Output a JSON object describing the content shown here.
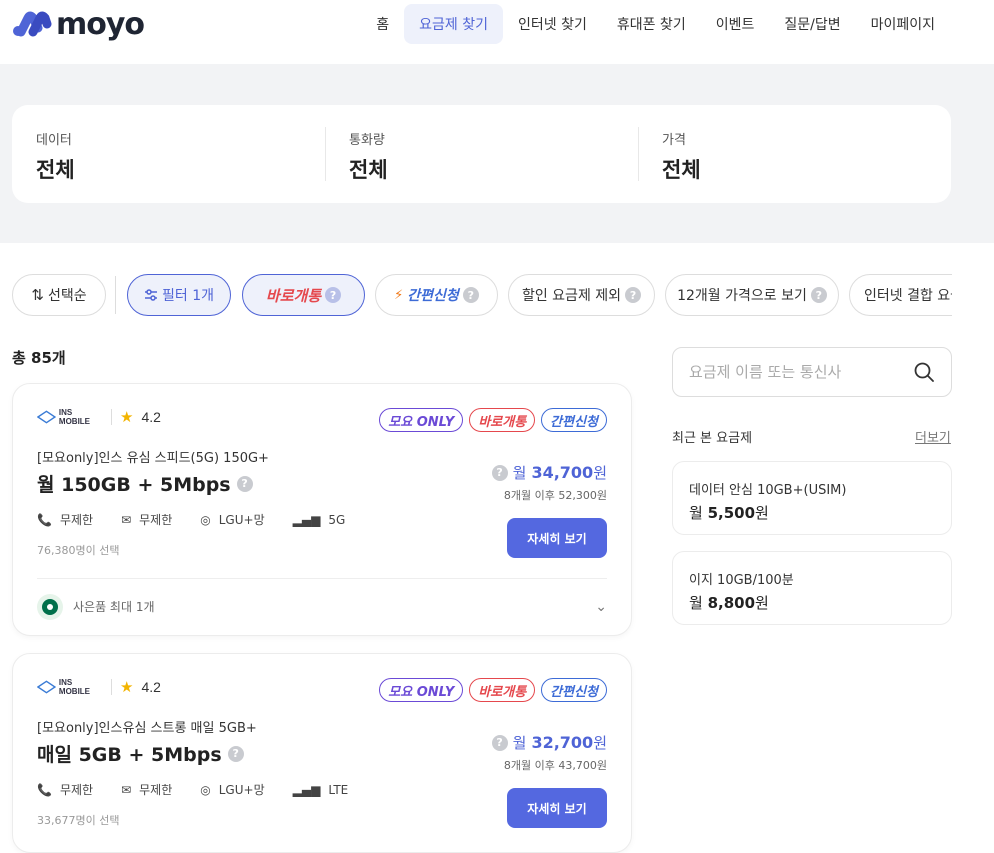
{
  "header": {
    "logo_text": "moyo",
    "nav": [
      "홈",
      "요금제 찾기",
      "인터넷 찾기",
      "휴대폰 찾기",
      "이벤트",
      "질문/답변",
      "마이페이지"
    ]
  },
  "filters": [
    {
      "label": "데이터",
      "value": "전체"
    },
    {
      "label": "통화량",
      "value": "전체"
    },
    {
      "label": "가격",
      "value": "전체"
    }
  ],
  "chips": {
    "sort": "선택순",
    "filter": "필터 1개",
    "instant": "바로개통",
    "easy": "간편신청",
    "exclude_discount": "할인 요금제 제외",
    "twelve_month": "12개월 가격으로 보기",
    "internet": "인터넷 결합 요금"
  },
  "total": "총 85개",
  "plans": [
    {
      "carrier": "INS MOBILE",
      "rating": "4.2",
      "badges": [
        "모요 ONLY",
        "바로개통",
        "간편신청"
      ],
      "name": "[모요only]인스 유심 스피드(5G) 150G+",
      "title": "월 150GB + 5Mbps",
      "specs": [
        "무제한",
        "무제한",
        "LGU+망",
        "5G"
      ],
      "chosen": "76,380명이 선택",
      "price_prefix": "월",
      "price": "34,700",
      "price_unit": "원",
      "after": "8개월 이후 52,300원",
      "detail": "자세히 보기",
      "gift": "사은품 최대 1개"
    },
    {
      "carrier": "INS MOBILE",
      "rating": "4.2",
      "badges": [
        "모요 ONLY",
        "바로개통",
        "간편신청"
      ],
      "name": "[모요only]인스유심 스트롱 매일 5GB+",
      "title": "매일 5GB + 5Mbps",
      "specs": [
        "무제한",
        "무제한",
        "LGU+망",
        "LTE"
      ],
      "chosen": "33,677명이 선택",
      "price_prefix": "월",
      "price": "32,700",
      "price_unit": "원",
      "after": "8개월 이후 43,700원",
      "detail": "자세히 보기"
    }
  ],
  "search": {
    "placeholder": "요금제 이름 또는 통신사"
  },
  "recent": {
    "title": "최근 본 요금제",
    "more": "더보기",
    "items": [
      {
        "name": "데이터 안심 10GB+(USIM)",
        "prefix": "월",
        "price": "5,500",
        "unit": "원"
      },
      {
        "name": "이지 10GB/100분",
        "prefix": "월",
        "price": "8,800",
        "unit": "원"
      }
    ]
  },
  "colors": {
    "accent": "#4f64d6",
    "button": "#5468e0",
    "instant": "#e5484d",
    "only": "#6b4ad6"
  }
}
